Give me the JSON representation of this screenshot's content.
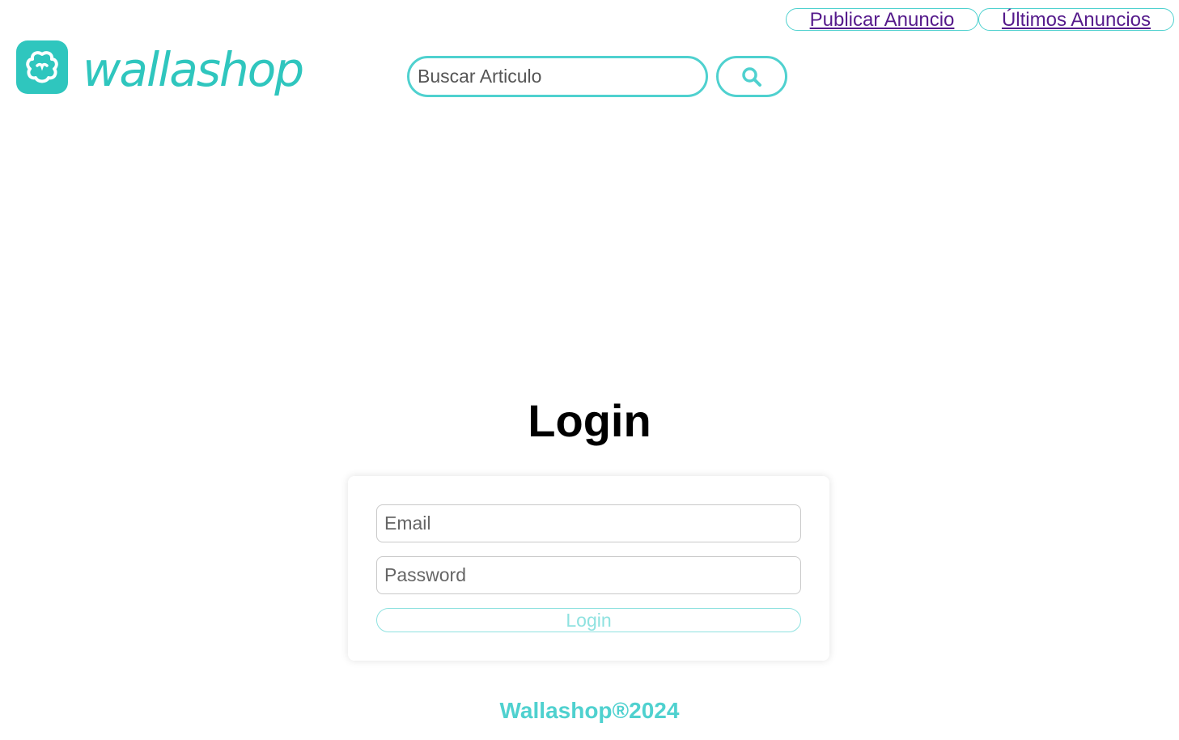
{
  "header": {
    "nav": [
      {
        "label": "Publicar Anuncio"
      },
      {
        "label": "Últimos Anuncios"
      }
    ],
    "logo": {
      "text": "wallashop",
      "icon": "wallapop-cloud-icon"
    },
    "search": {
      "placeholder": "Buscar Articulo",
      "value": "",
      "button_icon": "search-icon"
    }
  },
  "main": {
    "title": "Login",
    "form": {
      "email_placeholder": "Email",
      "password_placeholder": "Password",
      "submit_label": "Login"
    }
  },
  "footer": {
    "text": "Wallashop®2024"
  },
  "colors": {
    "accent": "#4fd1cf",
    "brand": "#2fc6be",
    "link": "#551a8b"
  }
}
